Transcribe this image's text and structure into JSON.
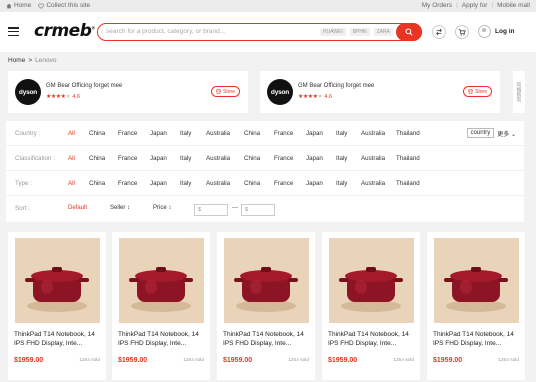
{
  "topbar": {
    "home": "Home",
    "collect": "Collect this site",
    "orders": "My Orders",
    "apply": "Apply for",
    "mobile": "Mobile mall"
  },
  "header": {
    "logo": "crmeb",
    "search_placeholder": "search for a product, category, or brand...",
    "search_tags": [
      "HUAWEI",
      "BPHN",
      "ZARA"
    ],
    "login": "Log in"
  },
  "breadcrumb": {
    "home": "Home",
    "sep": ">",
    "current": "Lenovo"
  },
  "stores": [
    {
      "logo": "dyson",
      "name": "GM Bear Officing forget mee",
      "rating": "4.6",
      "stars_filled": 4,
      "button": "Store"
    },
    {
      "logo": "dyson",
      "name": "GM Bear Officing forget mee",
      "rating": "4.6",
      "stars_filled": 4,
      "button": "Store"
    }
  ],
  "side_label": "风格新有",
  "filters": {
    "rows": [
      {
        "label": "Country :",
        "options": [
          "All",
          "China",
          "France",
          "Japan",
          "Italy",
          "Australia",
          "China",
          "France",
          "Japan",
          "Italy",
          "Australia",
          "Thailand"
        ],
        "extra_box": "country",
        "extra_more": "更多"
      },
      {
        "label": "Classification :",
        "options": [
          "All",
          "China",
          "France",
          "Japan",
          "Italy",
          "Australia",
          "China",
          "France",
          "Japan",
          "Italy",
          "Australia",
          "Thailand"
        ]
      },
      {
        "label": "Type :",
        "options": [
          "All",
          "China",
          "France",
          "Japan",
          "Italy",
          "Australia",
          "China",
          "France",
          "Japan",
          "Italy",
          "Australia",
          "Thailand"
        ]
      }
    ],
    "sort": {
      "label": "Sort :",
      "default": "Default",
      "seller": "Seller ↕",
      "price": "Price ↕",
      "price_from": "$",
      "price_to": "$",
      "dash": "—"
    }
  },
  "products": [
    {
      "title": "ThinkPad  T14  Notebook, 14 IPS FHD Display, Inte...",
      "price": "$1959.00",
      "sold": "1254 sold"
    },
    {
      "title": "ThinkPad  T14  Notebook, 14 IPS FHD Display, Inte...",
      "price": "$1959.00",
      "sold": "1254 sold"
    },
    {
      "title": "ThinkPad  T14  Notebook, 14 IPS FHD Display, Inte...",
      "price": "$1959.00",
      "sold": "1254 sold"
    },
    {
      "title": "ThinkPad  T14  Notebook, 14 IPS FHD Display, Inte...",
      "price": "$1959.00",
      "sold": "1254 sold"
    },
    {
      "title": "ThinkPad  T14  Notebook, 14 IPS FHD Display, Inte...",
      "price": "$1959.00",
      "sold": "1254 sold"
    }
  ],
  "colors": {
    "accent": "#e93323",
    "page_bg": "#f2f2f2"
  }
}
